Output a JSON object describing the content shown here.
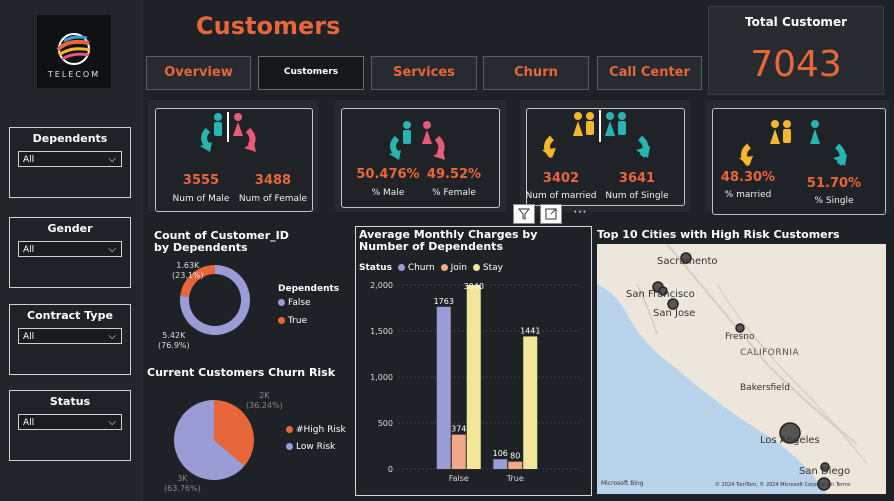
{
  "app": {
    "logo_text": "TELECOM",
    "page_title": "Customers"
  },
  "nav": [
    {
      "label": "Overview"
    },
    {
      "label": "Customers"
    },
    {
      "label": "Services"
    },
    {
      "label": "Churn"
    },
    {
      "label": "Call Center"
    }
  ],
  "total": {
    "label": "Total Customer",
    "value": "7043"
  },
  "slicers": [
    {
      "title": "Dependents",
      "value": "All"
    },
    {
      "title": "Gender",
      "value": "All"
    },
    {
      "title": "Contract Type",
      "value": "All"
    },
    {
      "title": "Status",
      "value": "All"
    }
  ],
  "kpi": {
    "male_count": "3555",
    "male_count_label": "Num of Male",
    "female_count": "3488",
    "female_count_label": "Num of Female",
    "male_pct": "50.476%",
    "male_pct_label": "% Male",
    "female_pct": "49.52%",
    "female_pct_label": "% Female",
    "married_count": "3402",
    "married_count_label": "Num of married",
    "single_count": "3641",
    "single_count_label": "Num of Single",
    "married_pct": "48.30%",
    "married_pct_label": "% married",
    "single_pct": "51.70%",
    "single_pct_label": "% Single"
  },
  "map": {
    "title": "Top 10 Cities with High Risk Customers",
    "labels": {
      "sacramento": "Sacramento",
      "san_francisco": "San Francisco",
      "san_jose": "San Jose",
      "fresno": "Fresno",
      "california": "CALIFORNIA",
      "bakersfield": "Bakersfield",
      "los_angeles": "Los Angeles",
      "san_diego": "San Diego"
    },
    "attribution": "© 2024 TomTom, © 2024 Microsoft Corporation  Terms",
    "bing": "Microsoft Bing"
  },
  "colors": {
    "accent": "#e8673a",
    "lavender": "#9b9bd6",
    "salmon": "#f2a98a",
    "cream": "#f3e59a",
    "teal": "#26b5b0",
    "pink": "#e85a7a",
    "yellow": "#f4b72e"
  },
  "chart_data": [
    {
      "type": "donut",
      "title": "Count of Customer_ID by Dependents",
      "legend_title": "Dependents",
      "categories": [
        "False",
        "True"
      ],
      "values": [
        5.42,
        1.63
      ],
      "display_values": [
        "5.42K",
        "1.63K"
      ],
      "display_pcts": [
        "(76.9%)",
        "(23.1%)"
      ],
      "unit": "K"
    },
    {
      "type": "pie",
      "title": "Current Customers Churn Risk",
      "categories": [
        "#High Risk",
        "Low Risk"
      ],
      "values": [
        2,
        3
      ],
      "display_values": [
        "2K",
        "3K"
      ],
      "display_pcts": [
        "(36.24%)",
        "(63.76%)"
      ],
      "percent": [
        36.24,
        63.76
      ]
    },
    {
      "type": "bar",
      "title": "Average Monthly Charges by Number of Dependents",
      "legend_title": "Status",
      "categories": [
        "False",
        "True"
      ],
      "series": [
        {
          "name": "Churn",
          "values": [
            1763,
            106
          ]
        },
        {
          "name": "Join",
          "values": [
            374,
            80
          ]
        },
        {
          "name": "Stay",
          "values": [
            3040,
            1441
          ]
        }
      ],
      "data_labels": [
        [
          "1763",
          "374",
          "3040"
        ],
        [
          "106",
          "80",
          "1441"
        ]
      ],
      "yticks": [
        "0",
        "500",
        "1,000",
        "1,500",
        "2,000"
      ],
      "ylim": [
        0,
        2000
      ]
    }
  ]
}
